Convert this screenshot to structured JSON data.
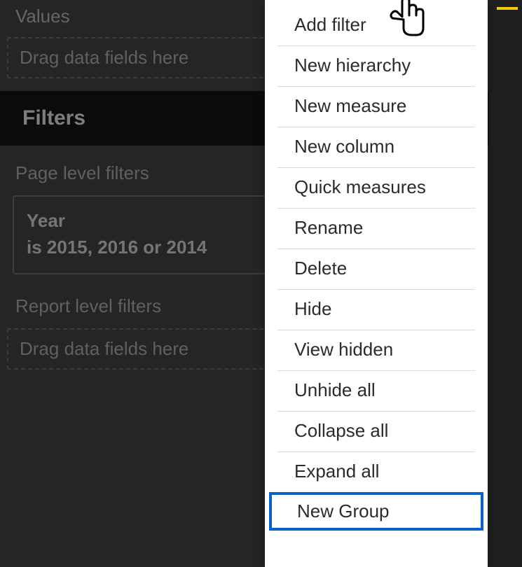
{
  "panel": {
    "values_label": "Values",
    "values_drop": "Drag data fields here",
    "filters_header": "Filters",
    "page_level_label": "Page level filters",
    "report_level_label": "Report level filters",
    "report_drop": "Drag data fields here",
    "filter_card": {
      "name": "Year",
      "state": "is 2015, 2016 or 2014"
    }
  },
  "menu": {
    "items": [
      "Add filter",
      "New hierarchy",
      "New measure",
      "New column",
      "Quick measures",
      "Rename",
      "Delete",
      "Hide",
      "View hidden",
      "Unhide all",
      "Collapse all",
      "Expand all",
      "New Group"
    ],
    "highlight_index": 12
  }
}
